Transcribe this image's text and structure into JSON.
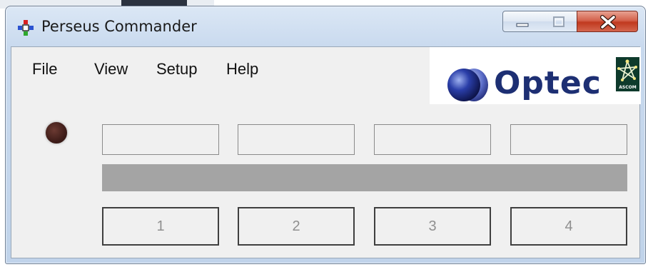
{
  "window": {
    "title": "Perseus Commander",
    "controls": [
      "minimize-icon",
      "maximize-icon",
      "close-icon"
    ]
  },
  "menu": {
    "items": [
      {
        "label": "File"
      },
      {
        "label": "View"
      },
      {
        "label": "Setup"
      },
      {
        "label": "Help"
      }
    ]
  },
  "logo": {
    "brand": "Optec",
    "badge": "ASCOM",
    "brand_color": "#1d2f73"
  },
  "status": {
    "indicator_color": "#3f1d19"
  },
  "display_fields": [
    "",
    "",
    "",
    ""
  ],
  "progress": {
    "value": 0,
    "color": "#a4a4a4"
  },
  "position_buttons": [
    {
      "label": "1"
    },
    {
      "label": "2"
    },
    {
      "label": "3"
    },
    {
      "label": "4"
    }
  ]
}
